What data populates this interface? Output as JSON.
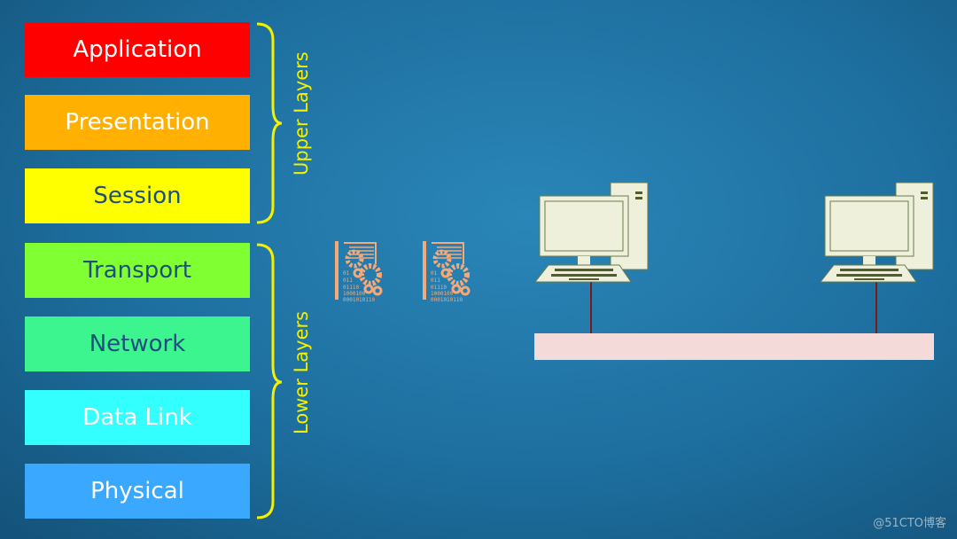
{
  "layers": [
    {
      "label": "Application",
      "bg": "#ff0000",
      "fg": "#ffffff"
    },
    {
      "label": "Presentation",
      "bg": "#ffb000",
      "fg": "#ffffff"
    },
    {
      "label": "Session",
      "bg": "#ffff00",
      "fg": "#1f4f7f"
    },
    {
      "label": "Transport",
      "bg": "#80ff33",
      "fg": "#1f4f7f"
    },
    {
      "label": "Network",
      "bg": "#3cf58f",
      "fg": "#1f4f7f"
    },
    {
      "label": "Data Link",
      "bg": "#33ffff",
      "fg": "#ffffff"
    },
    {
      "label": "Physical",
      "bg": "#3aa8ff",
      "fg": "#ffffff"
    }
  ],
  "groups": {
    "upper": "Upper Layers",
    "lower": "Lower Layers"
  },
  "icons": {
    "data_doc": "binary-gears-document-icon",
    "computer": "desktop-computer-icon"
  },
  "watermark": "@51CTO博客",
  "colors": {
    "brace": "#f4f000",
    "doc": "#f5a878",
    "computer": "#eef0dc",
    "bus": "#f5dada",
    "link": "#7a1a1a"
  }
}
